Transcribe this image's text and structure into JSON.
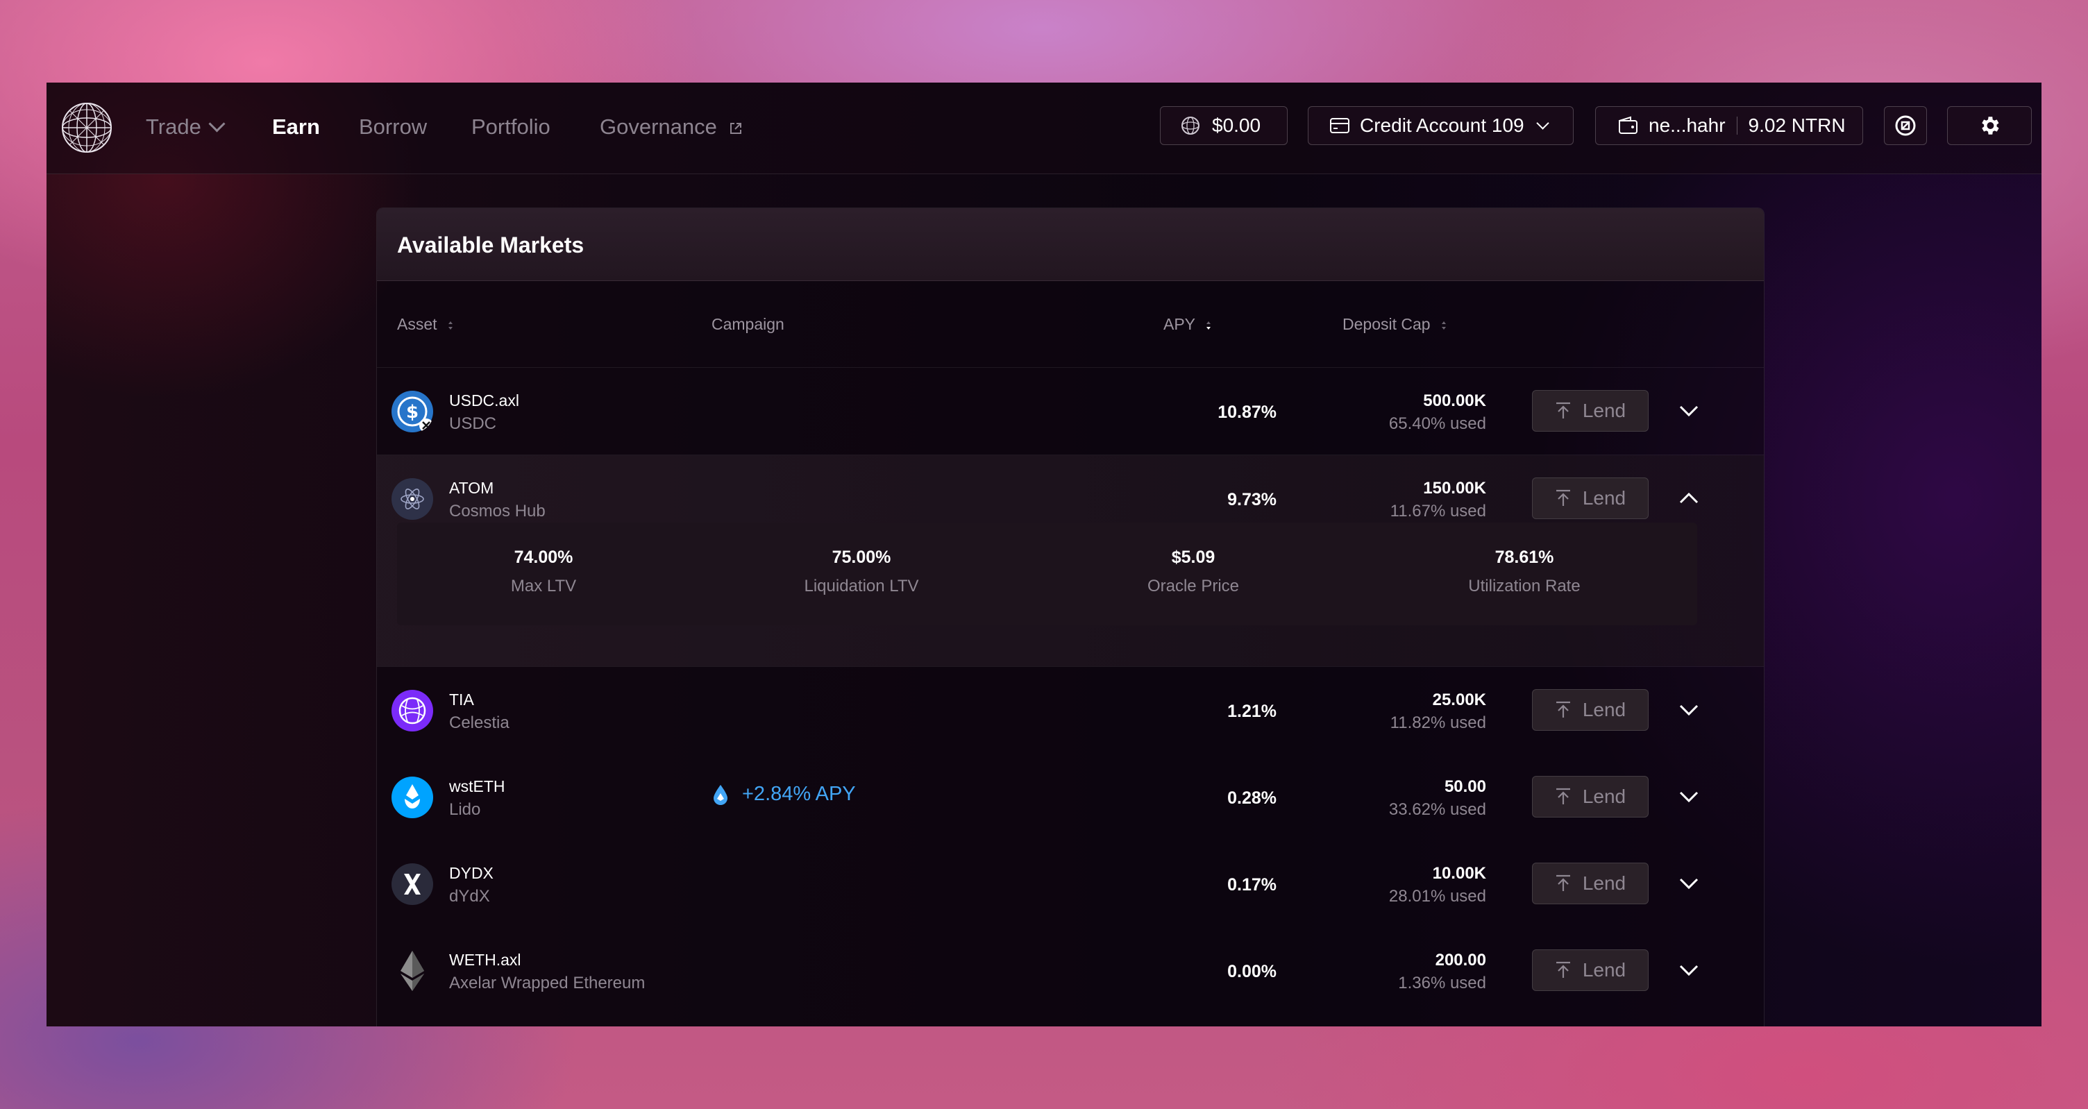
{
  "nav": {
    "items": [
      {
        "label": "Trade",
        "active": false,
        "dropdown": true
      },
      {
        "label": "Earn",
        "active": true
      },
      {
        "label": "Borrow",
        "active": false
      },
      {
        "label": "Portfolio",
        "active": false
      },
      {
        "label": "Governance",
        "active": false,
        "external": true
      }
    ],
    "balance": "$0.00",
    "credit_account": "Credit Account 109",
    "wallet_address": "ne...hahr",
    "wallet_balance": "9.02 NTRN"
  },
  "markets": {
    "title": "Available Markets",
    "columns": {
      "asset": "Asset",
      "campaign": "Campaign",
      "apy": "APY",
      "deposit_cap": "Deposit Cap"
    },
    "lend_label": "Lend",
    "rows": [
      {
        "symbol": "USDC.axl",
        "name": "USDC",
        "apy": "10.87%",
        "cap": "500.00K",
        "used": "65.40% used",
        "icon": "usdc-icon",
        "color": "#2775ca"
      },
      {
        "symbol": "ATOM",
        "name": "Cosmos Hub",
        "apy": "9.73%",
        "cap": "150.00K",
        "used": "11.67% used",
        "icon": "atom-icon",
        "color": "#2e3148",
        "expanded": true
      },
      {
        "symbol": "TIA",
        "name": "Celestia",
        "apy": "1.21%",
        "cap": "25.00K",
        "used": "11.82% used",
        "icon": "tia-icon",
        "color": "#7b2bf9"
      },
      {
        "symbol": "wstETH",
        "name": "Lido",
        "apy": "0.28%",
        "cap": "50.00",
        "used": "33.62% used",
        "icon": "lido-icon",
        "color": "#00a3ff",
        "campaign": "+2.84% APY"
      },
      {
        "symbol": "DYDX",
        "name": "dYdX",
        "apy": "0.17%",
        "cap": "10.00K",
        "used": "28.01% used",
        "icon": "dydx-icon",
        "color": "#1f1f2e"
      },
      {
        "symbol": "WETH.axl",
        "name": "Axelar Wrapped Ethereum",
        "apy": "0.00%",
        "cap": "200.00",
        "used": "1.36% used",
        "icon": "eth-icon",
        "color": "#627eea"
      }
    ],
    "details": [
      {
        "value": "74.00%",
        "label": "Max LTV"
      },
      {
        "value": "75.00%",
        "label": "Liquidation LTV"
      },
      {
        "value": "$5.09",
        "label": "Oracle Price"
      },
      {
        "value": "78.61%",
        "label": "Utilization Rate"
      }
    ]
  }
}
